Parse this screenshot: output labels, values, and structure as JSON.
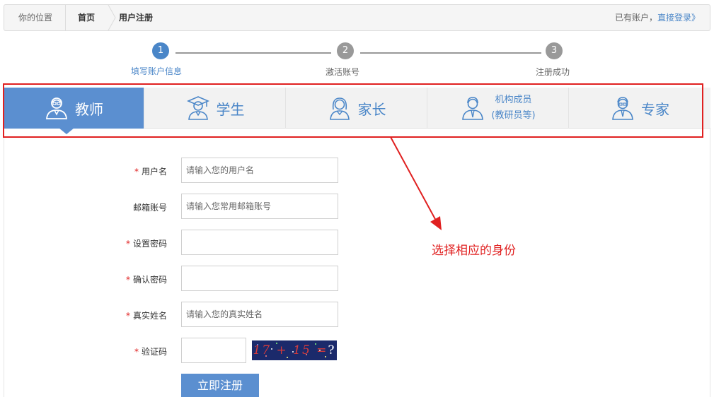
{
  "breadcrumb": {
    "location_label": "你的位置",
    "home": "首页",
    "current": "用户注册",
    "account_prefix": "已有账户，",
    "login_link": "直接登录》"
  },
  "steps": [
    {
      "number": "1",
      "label": "填写账户信息",
      "active": true
    },
    {
      "number": "2",
      "label": "激活账号",
      "active": false
    },
    {
      "number": "3",
      "label": "注册成功",
      "active": false
    }
  ],
  "colors": {
    "accent": "#5b8fd0",
    "link": "#4a86c8",
    "step_active": "#4a86c8",
    "step_inactive": "#999999",
    "annotation": "#e02020"
  },
  "tabs": [
    {
      "label": "教师",
      "icon": "teacher-icon",
      "active": true
    },
    {
      "label": "学生",
      "icon": "student-icon",
      "active": false
    },
    {
      "label": "家长",
      "icon": "parent-icon",
      "active": false
    },
    {
      "label_line1": "机构成员",
      "label_line2": "(教研员等)",
      "icon": "institution-member-icon",
      "active": false
    },
    {
      "label": "专家",
      "icon": "expert-icon",
      "active": false
    }
  ],
  "annotation": {
    "text": "选择相应的身份"
  },
  "form": {
    "username": {
      "required": true,
      "label": "用户名",
      "placeholder": "请输入您的用户名"
    },
    "email": {
      "required": false,
      "label": "邮箱账号",
      "placeholder": "请输入您常用邮箱账号"
    },
    "password": {
      "required": true,
      "label": "设置密码",
      "placeholder": ""
    },
    "confirm": {
      "required": true,
      "label": "确认密码",
      "placeholder": ""
    },
    "realname": {
      "required": true,
      "label": "真实姓名",
      "placeholder": "请输入您的真实姓名"
    },
    "captcha": {
      "required": true,
      "label": "验证码",
      "placeholder": "",
      "image_text": "17 + 15 =",
      "image_q": "?"
    },
    "required_mark": "*",
    "submit_label": "立即注册"
  }
}
